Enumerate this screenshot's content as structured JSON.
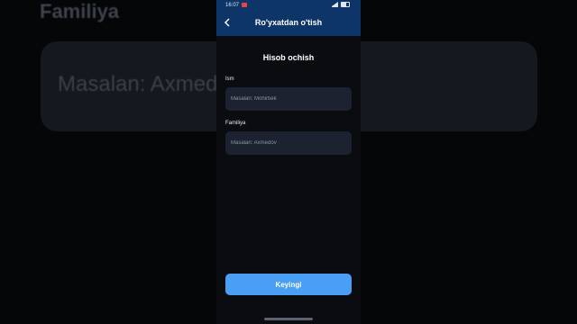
{
  "background": {
    "label": "Familiya",
    "placeholder": "Masalan: Axmedov"
  },
  "status_bar": {
    "time": "16:07"
  },
  "app_bar": {
    "title": "Ro'yxatdan o'tish"
  },
  "form": {
    "title": "Hisob ochish",
    "first_name": {
      "label": "Ism",
      "placeholder": "Masalan: Mohirbek"
    },
    "last_name": {
      "label": "Familiya",
      "placeholder": "Masalan: Axmedov"
    },
    "next_label": "Keyingi"
  },
  "colors": {
    "app_bar": "#0d3568",
    "accent": "#4a9ff5",
    "screen_bg": "#0a0c10",
    "field_bg": "#1c2230"
  }
}
